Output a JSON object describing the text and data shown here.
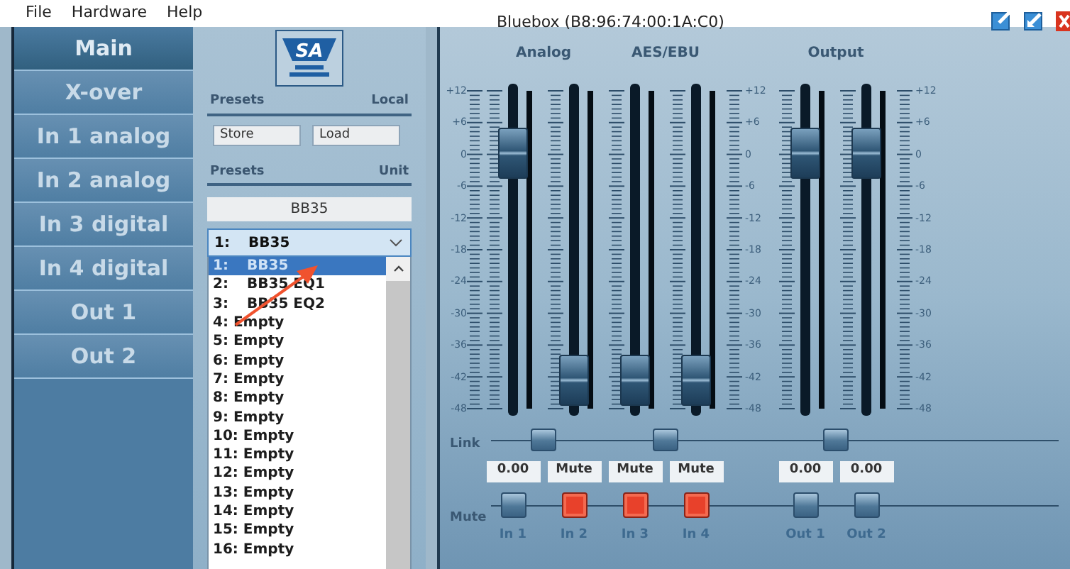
{
  "menu": [
    "File",
    "Hardware",
    "Help"
  ],
  "window": {
    "title": "Bluebox (B8:96:74:00:1A:C0)"
  },
  "nav": [
    {
      "label": "Main",
      "selected": true
    },
    {
      "label": "X-over",
      "selected": false
    },
    {
      "label": "In 1 analog",
      "selected": false
    },
    {
      "label": "In 2 analog",
      "selected": false
    },
    {
      "label": "In 3 digital",
      "selected": false
    },
    {
      "label": "In 4 digital",
      "selected": false
    },
    {
      "label": "Out 1",
      "selected": false
    },
    {
      "label": "Out 2",
      "selected": false
    }
  ],
  "presets": {
    "logo_text": "SA",
    "local_header": {
      "title": "Presets",
      "scope": "Local"
    },
    "buttons": [
      "Store",
      "Load"
    ],
    "unit_header": {
      "title": "Presets",
      "scope": "Unit"
    },
    "name_field": {
      "value": "BB35"
    },
    "dropdown": {
      "number": "1:",
      "name": "BB35",
      "expanded": true
    },
    "options": [
      {
        "kind": "named",
        "number": "1:",
        "name": "BB35",
        "selected": true
      },
      {
        "kind": "named",
        "number": "2:",
        "name": "BB35 EQ1",
        "selected": false
      },
      {
        "kind": "named",
        "number": "3:",
        "name": "BB35 EQ2",
        "selected": false
      },
      {
        "kind": "empty",
        "number": "4:",
        "name": "Empty",
        "selected": false
      },
      {
        "kind": "empty",
        "number": "5:",
        "name": "Empty",
        "selected": false
      },
      {
        "kind": "empty",
        "number": "6:",
        "name": "Empty",
        "selected": false
      },
      {
        "kind": "empty",
        "number": "7:",
        "name": "Empty",
        "selected": false
      },
      {
        "kind": "empty",
        "number": "8:",
        "name": "Empty",
        "selected": false
      },
      {
        "kind": "empty",
        "number": "9:",
        "name": "Empty",
        "selected": false
      },
      {
        "kind": "empty",
        "number": "10:",
        "name": "Empty",
        "selected": false
      },
      {
        "kind": "empty",
        "number": "11:",
        "name": "Empty",
        "selected": false
      },
      {
        "kind": "empty",
        "number": "12:",
        "name": "Empty",
        "selected": false
      },
      {
        "kind": "empty",
        "number": "13:",
        "name": "Empty",
        "selected": false
      },
      {
        "kind": "empty",
        "number": "14:",
        "name": "Empty",
        "selected": false
      },
      {
        "kind": "empty",
        "number": "15:",
        "name": "Empty",
        "selected": false
      },
      {
        "kind": "empty",
        "number": "16:",
        "name": "Empty",
        "selected": false
      }
    ]
  },
  "mixer": {
    "groups": [
      "Analog",
      "AES/EBU",
      "Output"
    ],
    "scales": [
      {
        "labels": [
          "+12",
          "+6",
          "0",
          "-6",
          "-12",
          "-18",
          "-24",
          "-30",
          "-36",
          "-42",
          "-48"
        ]
      },
      {
        "labels": [
          "+12",
          "+6",
          "0",
          "-6",
          "-12",
          "-18",
          "-24",
          "-30",
          "-36",
          "-42",
          "-48"
        ]
      },
      {
        "labels": [
          "+12",
          "+6",
          "0",
          "-6",
          "-12",
          "-18",
          "-24",
          "-30",
          "-36",
          "-42",
          "-48"
        ]
      }
    ],
    "link_label": "Link",
    "mute_label": "Mute",
    "channels": [
      {
        "name": "In 1",
        "level": 0.85,
        "value": "0.00",
        "muted": false
      },
      {
        "name": "In 2",
        "level": 0,
        "value": "Mute",
        "muted": true
      },
      {
        "name": "In 3",
        "level": 0,
        "value": "Mute",
        "muted": true
      },
      {
        "name": "In 4",
        "level": 0,
        "value": "Mute",
        "muted": true
      },
      {
        "name": "Out 1",
        "level": 0.85,
        "value": "0.00",
        "muted": false
      },
      {
        "name": "Out 2",
        "level": 0.85,
        "value": "0.00",
        "muted": false
      }
    ]
  }
}
